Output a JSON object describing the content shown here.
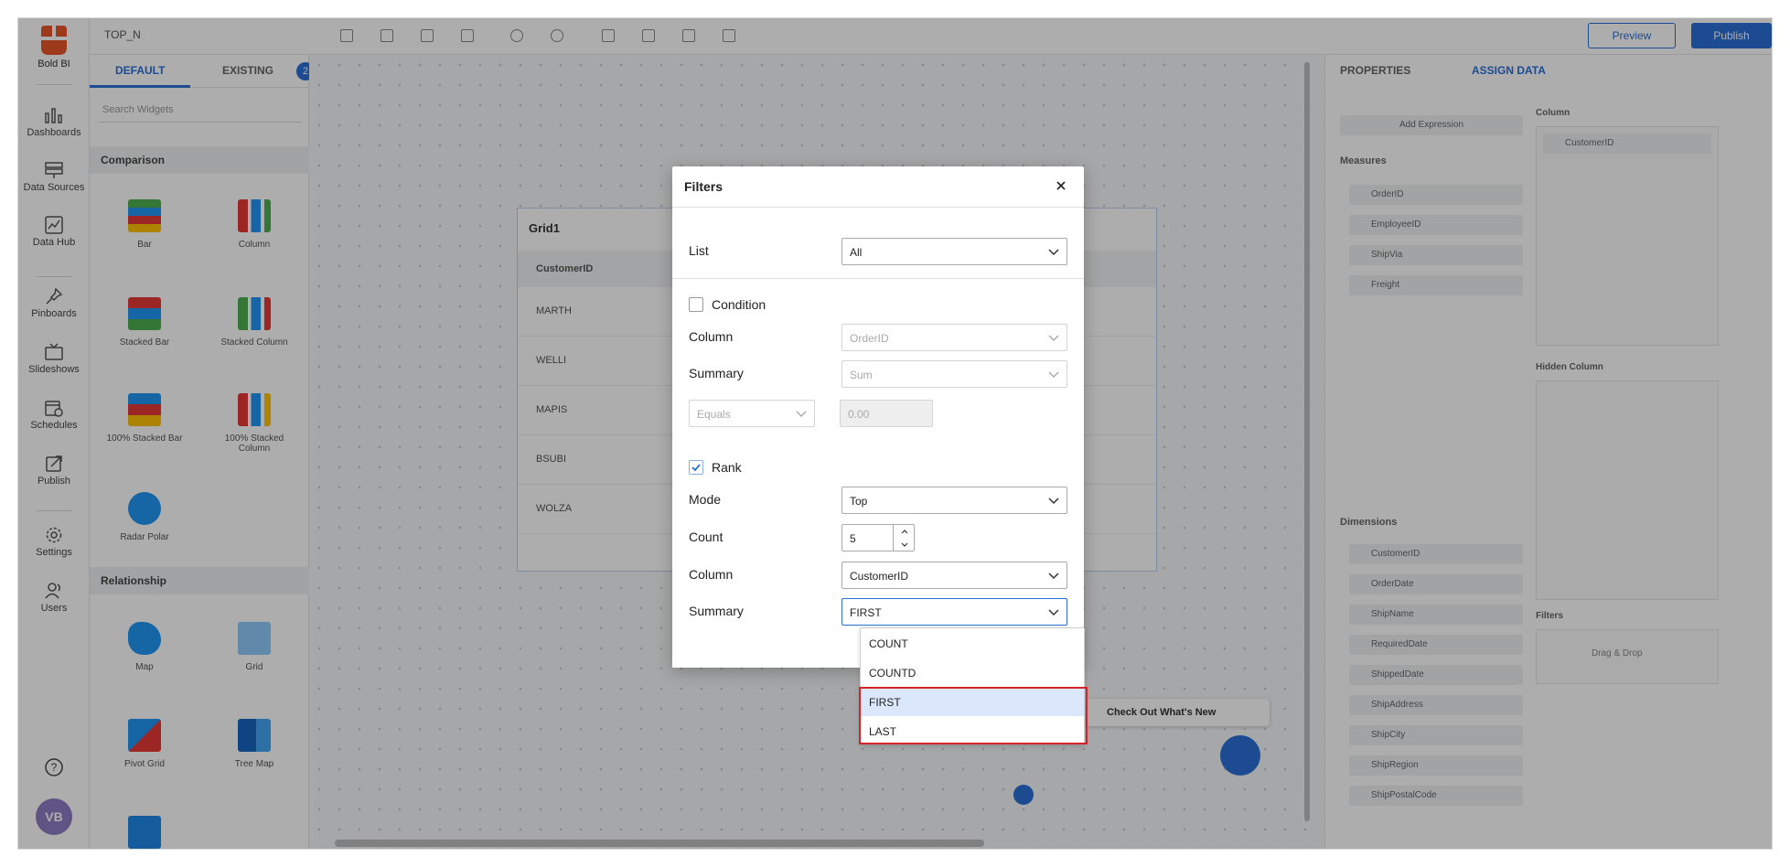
{
  "app": {
    "logo_text": "Bold BI",
    "dashboard_title": "TOP_N"
  },
  "nav": [
    {
      "label": "Dashboards",
      "icon": "bar-chart-icon"
    },
    {
      "label": "Data Sources",
      "icon": "data-sources-icon"
    },
    {
      "label": "Data Hub",
      "icon": "data-hub-icon"
    },
    {
      "label": "Pinboards",
      "icon": "pin-icon"
    },
    {
      "label": "Slideshows",
      "icon": "tv-icon"
    },
    {
      "label": "Schedules",
      "icon": "calendar-icon"
    },
    {
      "label": "Publish",
      "icon": "publish-icon"
    },
    {
      "label": "Settings",
      "icon": "gear-icon"
    },
    {
      "label": "Users",
      "icon": "users-icon"
    }
  ],
  "avatar_initials": "VB",
  "topbar": {
    "preview": "Preview",
    "publish": "Publish"
  },
  "widget_panel": {
    "tabs": [
      "DEFAULT",
      "EXISTING"
    ],
    "badge": "2",
    "search_placeholder": "Search Widgets",
    "categories": [
      "Comparison",
      "Relationship"
    ],
    "widgets": [
      "Bar",
      "Column",
      "Stacked Bar",
      "Stacked Column",
      "100% Stacked Bar",
      "100% Stacked Column",
      "Radar Polar",
      "Map",
      "Grid",
      "Pivot Grid",
      "Tree Map"
    ]
  },
  "canvas": {
    "grid_title": "Grid1",
    "grid_header": "CustomerID",
    "grid_rows": [
      "MARTH",
      "WELLI",
      "MAPIS",
      "BSUBI",
      "WOLZA"
    ],
    "whats_new": "Check Out What's New"
  },
  "right_panel": {
    "tabs": [
      "PROPERTIES",
      "ASSIGN DATA"
    ],
    "add_expression": "Add Expression",
    "measures_label": "Measures",
    "dimensions_label": "Dimensions",
    "columns_label": "Column",
    "hidden_columns_label": "Hidden Column",
    "filters_label": "Filters",
    "drag_drop": "Drag & Drop",
    "column_pill": "CustomerID",
    "measures": [
      "OrderID",
      "EmployeeID",
      "ShipVia",
      "Freight"
    ],
    "dimensions": [
      "CustomerID",
      "OrderDate",
      "ShipName",
      "RequiredDate",
      "ShippedDate",
      "ShipAddress",
      "ShipCity",
      "ShipRegion",
      "ShipPostalCode"
    ]
  },
  "dialog": {
    "title": "Filters",
    "list_label": "List",
    "list_value": "All",
    "condition_label": "Condition",
    "condition_checked": false,
    "column_label": "Column",
    "condition_column_value": "OrderID",
    "summary_label": "Summary",
    "condition_summary_value": "Sum",
    "operator_value": "Equals",
    "operator_input_value": "0.00",
    "rank_label": "Rank",
    "rank_checked": true,
    "mode_label": "Mode",
    "mode_value": "Top",
    "count_label": "Count",
    "count_value": "5",
    "rank_column_value": "CustomerID",
    "rank_summary_value": "FIRST"
  },
  "summary_options": [
    "COUNT",
    "COUNTD",
    "FIRST",
    "LAST"
  ],
  "summary_selected": "FIRST",
  "colors": {
    "accent": "#2b6fd6",
    "highlight_box": "#d9232a",
    "selected_option": "#dbe7fa"
  }
}
